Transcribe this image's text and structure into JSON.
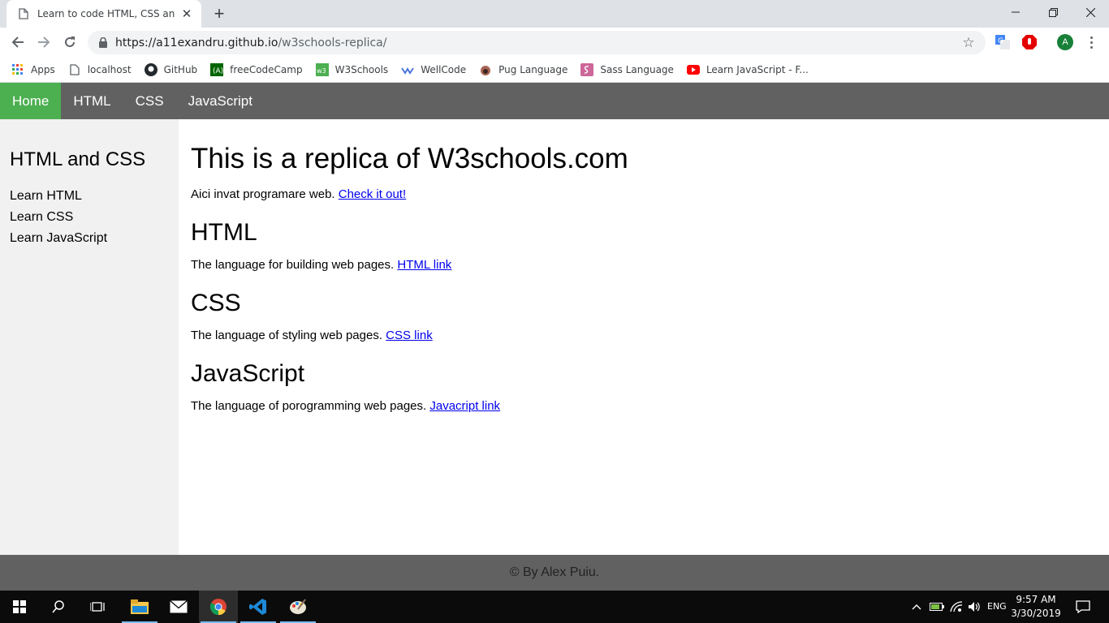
{
  "browser": {
    "tab_title": "Learn to code HTML, CSS and JavaScript",
    "url_host": "https://a11exandru.github.io",
    "url_path": "/w3schools-replica/",
    "profile_initial": "A",
    "bookmarks": [
      {
        "label": "Apps",
        "icon": "apps-grid-icon"
      },
      {
        "label": "localhost",
        "icon": "page-icon"
      },
      {
        "label": "GitHub",
        "icon": "github-icon"
      },
      {
        "label": "freeCodeCamp",
        "icon": "freecodecamp-icon"
      },
      {
        "label": "W3Schools",
        "icon": "w3schools-icon"
      },
      {
        "label": "WellCode",
        "icon": "wellcode-icon"
      },
      {
        "label": "Pug Language",
        "icon": "pug-icon"
      },
      {
        "label": "Sass Language",
        "icon": "sass-icon"
      },
      {
        "label": "Learn JavaScript - F...",
        "icon": "youtube-icon"
      }
    ]
  },
  "nav": {
    "items": [
      {
        "label": "Home",
        "active": true
      },
      {
        "label": "HTML"
      },
      {
        "label": "CSS"
      },
      {
        "label": "JavaScript"
      }
    ]
  },
  "sidebar": {
    "title": "HTML and CSS",
    "links": [
      "Learn HTML",
      "Learn CSS",
      "Learn JavaScript"
    ]
  },
  "main": {
    "title": "This is a replica of W3schools.com",
    "intro_text": "Aici invat programare web. ",
    "intro_link": "Check it out!",
    "sections": [
      {
        "heading": "HTML",
        "text": "The language for building web pages. ",
        "link": "HTML link"
      },
      {
        "heading": "CSS",
        "text": "The language of styling web pages. ",
        "link": "CSS link"
      },
      {
        "heading": "JavaScript",
        "text": "The language of porogramming web pages. ",
        "link": "Javacript link"
      }
    ]
  },
  "footer": {
    "text": "© By Alex Puiu."
  },
  "taskbar": {
    "language": "ENG",
    "time": "9:57 AM",
    "date": "3/30/2019"
  },
  "colors": {
    "nav_bg": "#616161",
    "nav_active": "#4caf50",
    "sidebar_bg": "#f1f1f1",
    "link": "#0000ee"
  }
}
